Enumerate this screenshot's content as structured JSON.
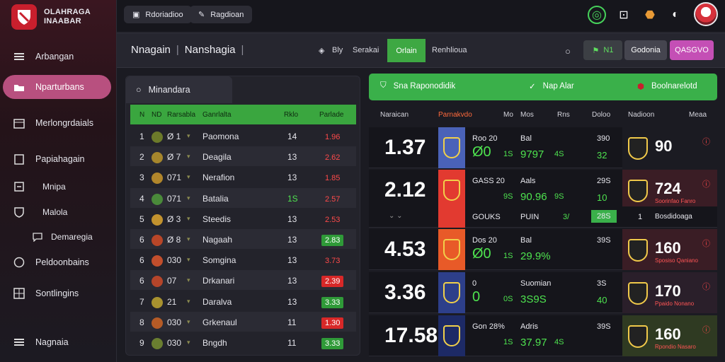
{
  "brand": {
    "line1": "OLAHRAGA",
    "line2": "INAABAR"
  },
  "sidebar": {
    "items": [
      {
        "label": "Arbangan"
      },
      {
        "label": "Nparturbans"
      },
      {
        "label": "Merlongrdaials"
      },
      {
        "label": "Papiahagain"
      },
      {
        "label": "Mnipa"
      },
      {
        "label": "Malola"
      },
      {
        "label": "Demaregia"
      },
      {
        "label": "Peldoonbains"
      },
      {
        "label": "Sontlingins"
      },
      {
        "label": "Nagnaia"
      }
    ]
  },
  "topbar": {
    "btn1": "Rdoriadioo",
    "btn2": "Ragdioan"
  },
  "subheader": {
    "crumb1": "Nnagain",
    "crumb2": "Nanshagia",
    "item1": "Bly",
    "item2": "Serakai",
    "active_tab": "Orlain",
    "item3": "Renhlioua",
    "btn_green": "N1",
    "btn_gray": "Godonia",
    "btn_pink": "QASGVO"
  },
  "left_panel": {
    "tab": "Minandara",
    "headers": [
      "N",
      "ND",
      "Rarsabla",
      "Ganrlalta",
      "Rklo",
      "Parlade"
    ],
    "rows": [
      {
        "n": "1",
        "code": "Ø 1",
        "name": "Paomona",
        "num": "14",
        "val": "1.96",
        "style": "red"
      },
      {
        "n": "2",
        "code": "Ø 7",
        "name": "Deagila",
        "num": "13",
        "val": "2.62",
        "style": "red"
      },
      {
        "n": "3",
        "code": "071",
        "name": "Nerafion",
        "num": "13",
        "val": "1.85",
        "style": "red"
      },
      {
        "n": "4",
        "code": "071",
        "name": "Batalia",
        "num": "1S",
        "val": "2.57",
        "style": "red"
      },
      {
        "n": "5",
        "code": "Ø 3",
        "name": "Steedis",
        "num": "13",
        "val": "2.53",
        "style": "red"
      },
      {
        "n": "6",
        "code": "Ø 8",
        "name": "Nagaah",
        "num": "13",
        "val": "2.83",
        "style": "chip-green"
      },
      {
        "n": "6",
        "code": "030",
        "name": "Somgina",
        "num": "13",
        "val": "3.73",
        "style": "red"
      },
      {
        "n": "6",
        "code": "07",
        "name": "Drkanari",
        "num": "13",
        "val": "2.39",
        "style": "chip-red"
      },
      {
        "n": "7",
        "code": "21",
        "name": "Daralva",
        "num": "13",
        "val": "3.33",
        "style": "chip-green"
      },
      {
        "n": "8",
        "code": "030",
        "name": "Grkenaul",
        "num": "11",
        "val": "1.30",
        "style": "chip-red"
      },
      {
        "n": "9",
        "code": "030",
        "name": "Bngdh",
        "num": "11",
        "val": "3.33",
        "style": "chip-green"
      }
    ]
  },
  "right_panel": {
    "banner": {
      "item1": "Sna Raponodidik",
      "item2": "Nap Alar",
      "item3": "Boolnarelotd"
    },
    "headers": [
      "Naraican",
      "Parnakvdo",
      "Mo",
      "Mos",
      "Rns",
      "Doloo",
      "Nadioon",
      "Meaa"
    ],
    "cards": [
      {
        "big": "1.37",
        "t1": "Roo 20",
        "t2": "Bal",
        "sA": "Ø0",
        "sB": "1S",
        "sC": "9797",
        "sD": "4S",
        "r1": "390",
        "r2": "32",
        "score": "90",
        "sub": ""
      },
      {
        "big": "2.12",
        "t1": "GASS 20",
        "t2": "Aals",
        "sA": "",
        "sB": "9S",
        "sC": "90.96",
        "sD": "9S",
        "r1": "29S",
        "r2": "10",
        "score": "724",
        "sub": "Soorinfao Fanro"
      },
      {
        "big": "4.53",
        "t1": "Dos 20",
        "t2": "Bal",
        "sA": "Ø0",
        "sB": "1S",
        "sC": "29.9%",
        "sD": "",
        "r1": "39S",
        "r2": "",
        "score": "160",
        "sub": "Sposiso Qaniano"
      },
      {
        "big": "3.36",
        "t1": "0",
        "t2": "Suomian",
        "sA": "0",
        "sB": "0S",
        "sC": "3S9S",
        "sD": "",
        "r1": "3S",
        "r2": "40",
        "score": "170",
        "sub": "Ppaido Nonano"
      },
      {
        "big": "17.58",
        "t1": "Gon 28%",
        "t2": "Adris",
        "sA": "",
        "sB": "1S",
        "sC": "37.97",
        "sD": "4S",
        "r1": "39S",
        "r2": "",
        "score": "160",
        "sub": "Rpondio Nasaro"
      }
    ],
    "mid_row": {
      "a": "GOUKS",
      "b": "PUIN",
      "c": "3/",
      "d": "28S",
      "e": "1",
      "f": "Bosdidoaga"
    }
  },
  "colors": {
    "accent_green": "#3ab04a",
    "accent_pink": "#b8507f",
    "brand_red": "#c81f2d"
  }
}
